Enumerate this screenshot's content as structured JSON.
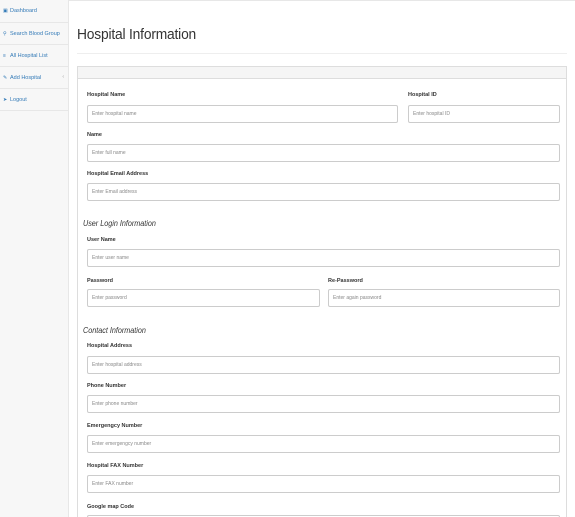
{
  "sidebar": {
    "items": [
      {
        "label": "Dashboard",
        "icon": "dashboard-icon"
      },
      {
        "label": "Search Blood Group",
        "icon": "search-icon"
      },
      {
        "label": "All Hospital List",
        "icon": "list-icon"
      },
      {
        "label": "Add Hospital",
        "icon": "edit-icon",
        "has_submenu": true
      },
      {
        "label": "Logout",
        "icon": "logout-icon"
      }
    ]
  },
  "page": {
    "title": "Hospital Information"
  },
  "form": {
    "hospital_name": {
      "label": "Hospital Name",
      "placeholder": "Enter hospital name"
    },
    "hospital_id": {
      "label": "Hospital ID",
      "placeholder": "Enter hospital ID"
    },
    "name": {
      "label": "Name",
      "placeholder": "Enter full name"
    },
    "email": {
      "label": "Hospital Email Address",
      "placeholder": "Enter Email address"
    },
    "login_section": "User Login Information",
    "user_name": {
      "label": "User Name",
      "placeholder": "Enter user name"
    },
    "password": {
      "label": "Password",
      "placeholder": "Enter password"
    },
    "re_password": {
      "label": "Re-Password",
      "placeholder": "Enter again password"
    },
    "contact_section": "Contact Information",
    "address": {
      "label": "Hospital Address",
      "placeholder": "Enter hospital address"
    },
    "phone": {
      "label": "Phone Number",
      "placeholder": "Enter phone number"
    },
    "emergency": {
      "label": "Emergengcy Number",
      "placeholder": "Enter emergengcy number"
    },
    "fax": {
      "label": "Hospital FAX Number",
      "placeholder": "Enter FAX number"
    },
    "map": {
      "label": "Google map Code"
    }
  }
}
